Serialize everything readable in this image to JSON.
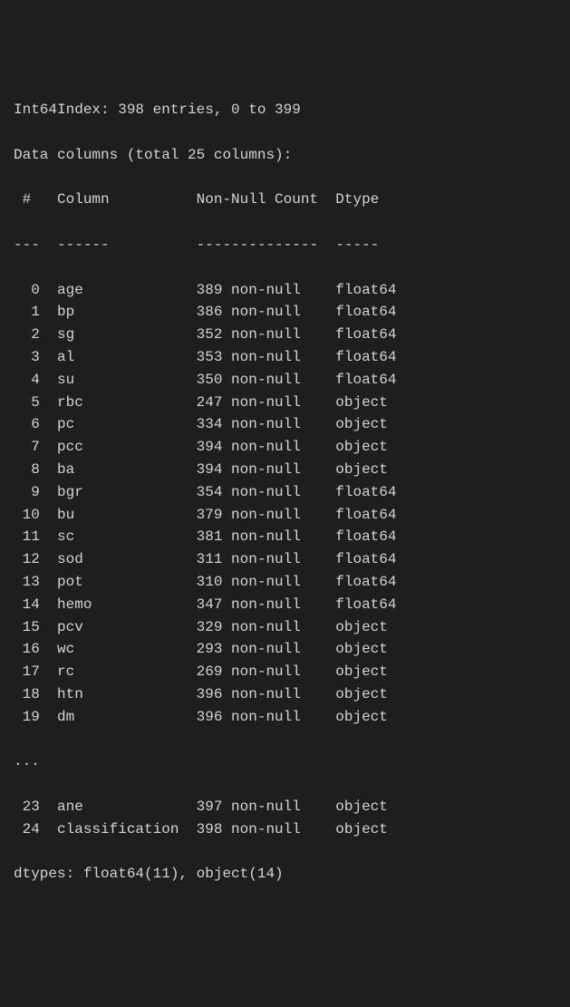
{
  "header": {
    "index_line": "Int64Index: 398 entries, 0 to 399",
    "columns_line": "Data columns (total 25 columns):"
  },
  "table_header": {
    "col1": "#",
    "col2": "Column",
    "col3": "Non-Null Count",
    "col4": "Dtype"
  },
  "separator": {
    "col1": "---",
    "col2": "------",
    "col3": "--------------",
    "col4": "-----"
  },
  "rows": [
    {
      "idx": "0",
      "name": "age",
      "count": "389 non-null",
      "dtype": "float64"
    },
    {
      "idx": "1",
      "name": "bp",
      "count": "386 non-null",
      "dtype": "float64"
    },
    {
      "idx": "2",
      "name": "sg",
      "count": "352 non-null",
      "dtype": "float64"
    },
    {
      "idx": "3",
      "name": "al",
      "count": "353 non-null",
      "dtype": "float64"
    },
    {
      "idx": "4",
      "name": "su",
      "count": "350 non-null",
      "dtype": "float64"
    },
    {
      "idx": "5",
      "name": "rbc",
      "count": "247 non-null",
      "dtype": "object"
    },
    {
      "idx": "6",
      "name": "pc",
      "count": "334 non-null",
      "dtype": "object"
    },
    {
      "idx": "7",
      "name": "pcc",
      "count": "394 non-null",
      "dtype": "object"
    },
    {
      "idx": "8",
      "name": "ba",
      "count": "394 non-null",
      "dtype": "object"
    },
    {
      "idx": "9",
      "name": "bgr",
      "count": "354 non-null",
      "dtype": "float64"
    },
    {
      "idx": "10",
      "name": "bu",
      "count": "379 non-null",
      "dtype": "float64"
    },
    {
      "idx": "11",
      "name": "sc",
      "count": "381 non-null",
      "dtype": "float64"
    },
    {
      "idx": "12",
      "name": "sod",
      "count": "311 non-null",
      "dtype": "float64"
    },
    {
      "idx": "13",
      "name": "pot",
      "count": "310 non-null",
      "dtype": "float64"
    },
    {
      "idx": "14",
      "name": "hemo",
      "count": "347 non-null",
      "dtype": "float64"
    },
    {
      "idx": "15",
      "name": "pcv",
      "count": "329 non-null",
      "dtype": "object"
    },
    {
      "idx": "16",
      "name": "wc",
      "count": "293 non-null",
      "dtype": "object"
    },
    {
      "idx": "17",
      "name": "rc",
      "count": "269 non-null",
      "dtype": "object"
    },
    {
      "idx": "18",
      "name": "htn",
      "count": "396 non-null",
      "dtype": "object"
    },
    {
      "idx": "19",
      "name": "dm",
      "count": "396 non-null",
      "dtype": "object"
    }
  ],
  "ellipsis": "...",
  "rows_after": [
    {
      "idx": "23",
      "name": "ane",
      "count": "397 non-null",
      "dtype": "object"
    },
    {
      "idx": "24",
      "name": "classification",
      "count": "398 non-null",
      "dtype": "object"
    }
  ],
  "footer": {
    "dtypes_line": "dtypes: float64(11), object(14)"
  }
}
